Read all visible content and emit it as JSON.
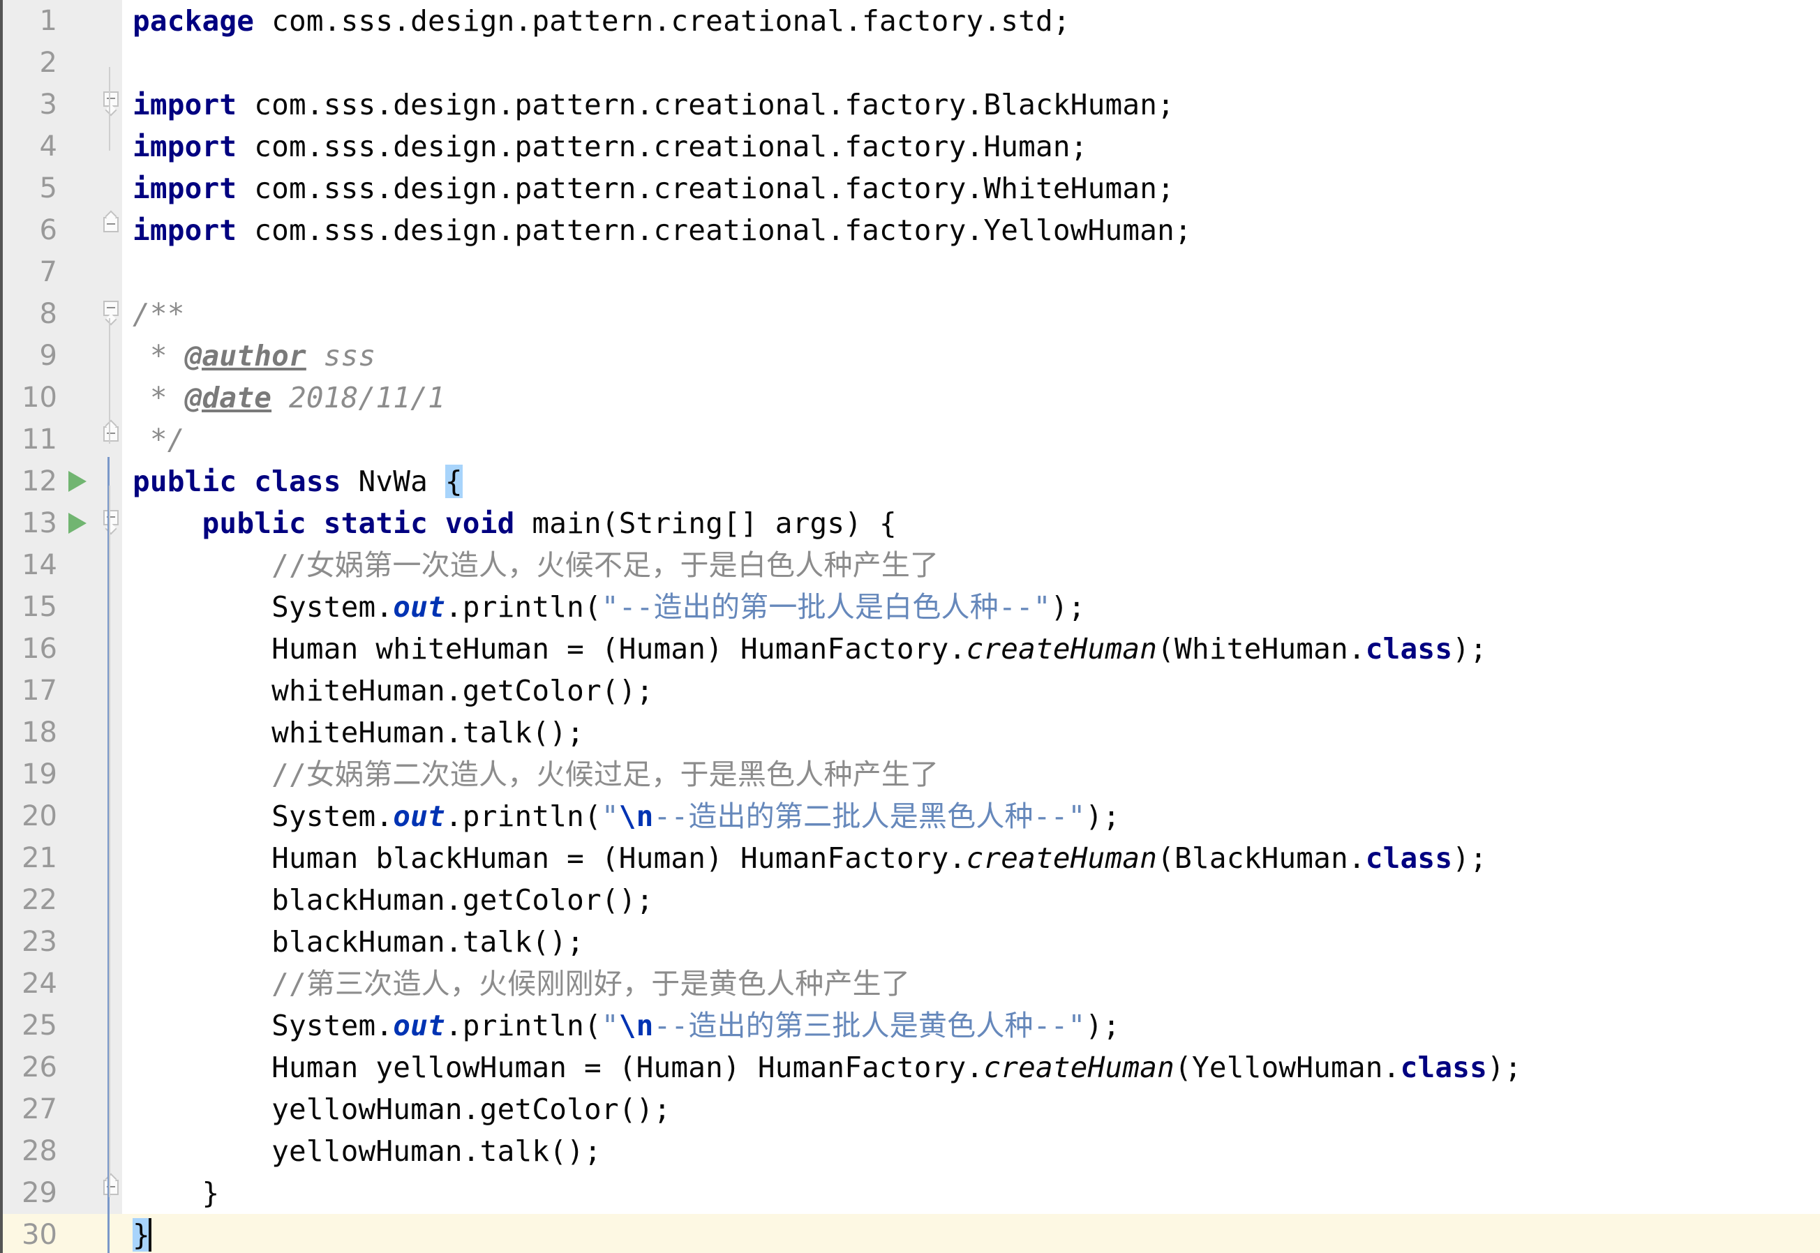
{
  "editor": {
    "app": "intellij-idea-editor",
    "language": "java",
    "colors": {
      "background": "#ffffff",
      "gutter_background": "#ededed",
      "line_number": "#999999",
      "keyword": "#000080",
      "string": "#6688bb",
      "escape": "#0033b3",
      "comment": "#8c8c8c",
      "static_field": "#0033b3",
      "brace_match_highlight": "#a8d4fb",
      "caret_line_highlight": "#fdf8e3",
      "run_marker": "#71b571",
      "scope_indicator": "#7a98c9"
    },
    "caret_line": 30,
    "total_lines": 30
  },
  "lines": [
    {
      "n": "1",
      "run": false,
      "fold": "",
      "tokens": [
        {
          "t": "package ",
          "c": "kw"
        },
        {
          "t": "com.sss.design.pattern.creational.factory.std;",
          "c": "ident"
        }
      ]
    },
    {
      "n": "2",
      "run": false,
      "fold": "",
      "tokens": []
    },
    {
      "n": "3",
      "run": false,
      "fold": "start",
      "tokens": [
        {
          "t": "import ",
          "c": "kw"
        },
        {
          "t": "com.sss.design.pattern.creational.factory.BlackHuman;",
          "c": "ident"
        }
      ]
    },
    {
      "n": "4",
      "run": false,
      "fold": "",
      "tokens": [
        {
          "t": "import ",
          "c": "kw"
        },
        {
          "t": "com.sss.design.pattern.creational.factory.Human;",
          "c": "ident"
        }
      ]
    },
    {
      "n": "5",
      "run": false,
      "fold": "",
      "tokens": [
        {
          "t": "import ",
          "c": "kw"
        },
        {
          "t": "com.sss.design.pattern.creational.factory.WhiteHuman;",
          "c": "ident"
        }
      ]
    },
    {
      "n": "6",
      "run": false,
      "fold": "end",
      "tokens": [
        {
          "t": "import ",
          "c": "kw"
        },
        {
          "t": "com.sss.design.pattern.creational.factory.YellowHuman;",
          "c": "ident"
        }
      ]
    },
    {
      "n": "7",
      "run": false,
      "fold": "",
      "tokens": []
    },
    {
      "n": "8",
      "run": false,
      "fold": "start",
      "tokens": [
        {
          "t": "/**",
          "c": "doc"
        }
      ]
    },
    {
      "n": "9",
      "run": false,
      "fold": "",
      "tokens": [
        {
          "t": " * ",
          "c": "doc"
        },
        {
          "t": "@author",
          "c": "doctag"
        },
        {
          "t": " sss",
          "c": "doc"
        }
      ]
    },
    {
      "n": "10",
      "run": false,
      "fold": "",
      "tokens": [
        {
          "t": " * ",
          "c": "doc"
        },
        {
          "t": "@date",
          "c": "doctag"
        },
        {
          "t": " 2018/11/1",
          "c": "doc"
        }
      ]
    },
    {
      "n": "11",
      "run": false,
      "fold": "end",
      "tokens": [
        {
          "t": " */",
          "c": "doc"
        }
      ]
    },
    {
      "n": "12",
      "run": true,
      "fold": "",
      "tokens": [
        {
          "t": "public class ",
          "c": "kw"
        },
        {
          "t": "NvWa ",
          "c": "ident"
        },
        {
          "t": "{",
          "c": "brace-hl"
        }
      ]
    },
    {
      "n": "13",
      "run": true,
      "fold": "start",
      "tokens": [
        {
          "t": "    ",
          "c": "ident"
        },
        {
          "t": "public static void ",
          "c": "kw"
        },
        {
          "t": "main(String[] args) {",
          "c": "ident"
        }
      ]
    },
    {
      "n": "14",
      "run": false,
      "fold": "",
      "tokens": [
        {
          "t": "        ",
          "c": "ident"
        },
        {
          "t": "//女娲第一次造人，火候不足，于是白色人种产生了",
          "c": "cmt"
        }
      ]
    },
    {
      "n": "15",
      "run": false,
      "fold": "",
      "tokens": [
        {
          "t": "        System.",
          "c": "ident"
        },
        {
          "t": "out",
          "c": "statfld"
        },
        {
          "t": ".println(",
          "c": "ident"
        },
        {
          "t": "\"--造出的第一批人是白色人种--\"",
          "c": "str"
        },
        {
          "t": ");",
          "c": "ident"
        }
      ]
    },
    {
      "n": "16",
      "run": false,
      "fold": "",
      "tokens": [
        {
          "t": "        Human whiteHuman = (Human) HumanFactory.",
          "c": "ident"
        },
        {
          "t": "createHuman",
          "c": "statmth"
        },
        {
          "t": "(WhiteHuman.",
          "c": "ident"
        },
        {
          "t": "class",
          "c": "kw"
        },
        {
          "t": ");",
          "c": "ident"
        }
      ]
    },
    {
      "n": "17",
      "run": false,
      "fold": "",
      "tokens": [
        {
          "t": "        whiteHuman.getColor();",
          "c": "ident"
        }
      ]
    },
    {
      "n": "18",
      "run": false,
      "fold": "",
      "tokens": [
        {
          "t": "        whiteHuman.talk();",
          "c": "ident"
        }
      ]
    },
    {
      "n": "19",
      "run": false,
      "fold": "",
      "tokens": [
        {
          "t": "        ",
          "c": "ident"
        },
        {
          "t": "//女娲第二次造人，火候过足，于是黑色人种产生了",
          "c": "cmt"
        }
      ]
    },
    {
      "n": "20",
      "run": false,
      "fold": "",
      "tokens": [
        {
          "t": "        System.",
          "c": "ident"
        },
        {
          "t": "out",
          "c": "statfld"
        },
        {
          "t": ".println(",
          "c": "ident"
        },
        {
          "t": "\"",
          "c": "str"
        },
        {
          "t": "\\n",
          "c": "esc"
        },
        {
          "t": "--造出的第二批人是黑色人种--\"",
          "c": "str"
        },
        {
          "t": ");",
          "c": "ident"
        }
      ]
    },
    {
      "n": "21",
      "run": false,
      "fold": "",
      "tokens": [
        {
          "t": "        Human blackHuman = (Human) HumanFactory.",
          "c": "ident"
        },
        {
          "t": "createHuman",
          "c": "statmth"
        },
        {
          "t": "(BlackHuman.",
          "c": "ident"
        },
        {
          "t": "class",
          "c": "kw"
        },
        {
          "t": ");",
          "c": "ident"
        }
      ]
    },
    {
      "n": "22",
      "run": false,
      "fold": "",
      "tokens": [
        {
          "t": "        blackHuman.getColor();",
          "c": "ident"
        }
      ]
    },
    {
      "n": "23",
      "run": false,
      "fold": "",
      "tokens": [
        {
          "t": "        blackHuman.talk();",
          "c": "ident"
        }
      ]
    },
    {
      "n": "24",
      "run": false,
      "fold": "",
      "tokens": [
        {
          "t": "        ",
          "c": "ident"
        },
        {
          "t": "//第三次造人，火候刚刚好，于是黄色人种产生了",
          "c": "cmt"
        }
      ]
    },
    {
      "n": "25",
      "run": false,
      "fold": "",
      "tokens": [
        {
          "t": "        System.",
          "c": "ident"
        },
        {
          "t": "out",
          "c": "statfld"
        },
        {
          "t": ".println(",
          "c": "ident"
        },
        {
          "t": "\"",
          "c": "str"
        },
        {
          "t": "\\n",
          "c": "esc"
        },
        {
          "t": "--造出的第三批人是黄色人种--\"",
          "c": "str"
        },
        {
          "t": ");",
          "c": "ident"
        }
      ]
    },
    {
      "n": "26",
      "run": false,
      "fold": "",
      "tokens": [
        {
          "t": "        Human yellowHuman = (Human) HumanFactory.",
          "c": "ident"
        },
        {
          "t": "createHuman",
          "c": "statmth"
        },
        {
          "t": "(YellowHuman.",
          "c": "ident"
        },
        {
          "t": "class",
          "c": "kw"
        },
        {
          "t": ");",
          "c": "ident"
        }
      ]
    },
    {
      "n": "27",
      "run": false,
      "fold": "",
      "tokens": [
        {
          "t": "        yellowHuman.getColor();",
          "c": "ident"
        }
      ]
    },
    {
      "n": "28",
      "run": false,
      "fold": "",
      "tokens": [
        {
          "t": "        yellowHuman.talk();",
          "c": "ident"
        }
      ]
    },
    {
      "n": "29",
      "run": false,
      "fold": "end",
      "tokens": [
        {
          "t": "    }",
          "c": "ident"
        }
      ]
    },
    {
      "n": "30",
      "run": false,
      "fold": "",
      "caret": true,
      "tokens": [
        {
          "t": "}",
          "c": "brace-hl"
        }
      ]
    }
  ]
}
